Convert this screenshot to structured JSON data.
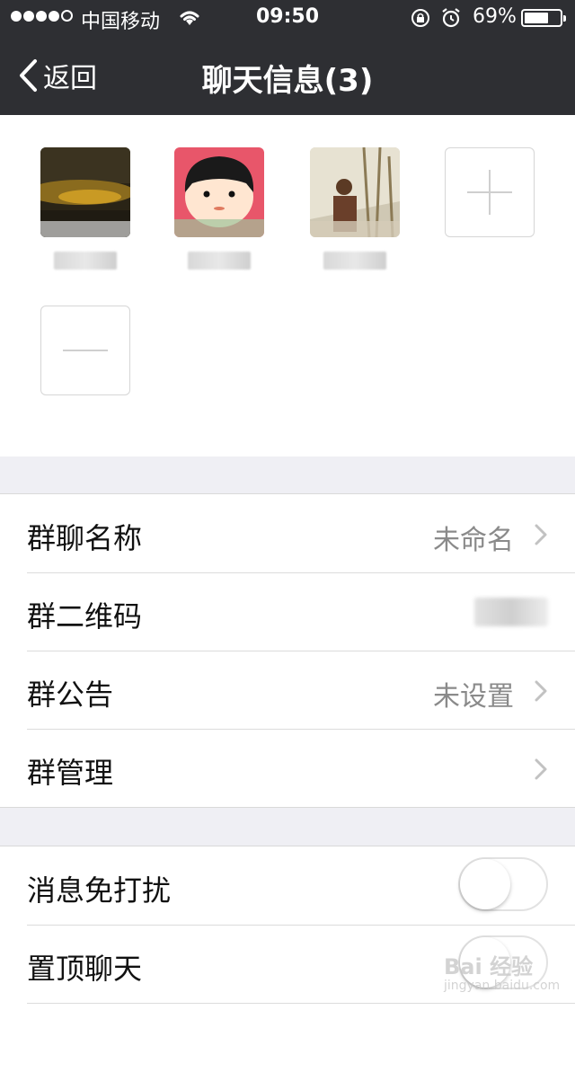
{
  "status_bar": {
    "carrier": "中国移动",
    "time": "09:50",
    "battery_percent": "69%",
    "battery_level": 0.69
  },
  "nav": {
    "back_label": "返回",
    "title": "聊天信息(3)"
  },
  "members": {
    "add_icon": "plus-icon",
    "remove_icon": "minus-icon"
  },
  "settings_group1": [
    {
      "label": "群聊名称",
      "value": "未命名"
    },
    {
      "label": "群二维码",
      "value": ""
    },
    {
      "label": "群公告",
      "value": "未设置"
    },
    {
      "label": "群管理",
      "value": ""
    }
  ],
  "settings_group2": [
    {
      "label": "消息免打扰",
      "enabled": false
    },
    {
      "label": "置顶聊天",
      "enabled": false
    }
  ],
  "watermark": {
    "text": "Bai 经验",
    "sub": "jingyan.baidu.com"
  },
  "colors": {
    "nav_bg": "#2e2f33",
    "page_bg": "#efeff4"
  }
}
